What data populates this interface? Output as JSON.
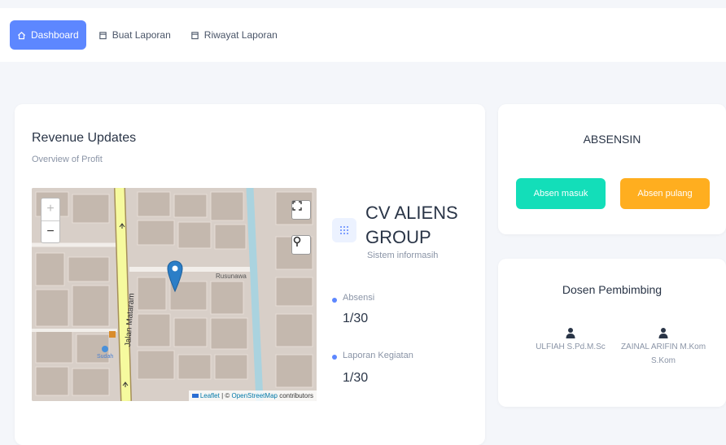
{
  "nav": {
    "items": [
      {
        "label": "Dashboard",
        "icon": "home-icon",
        "active": true
      },
      {
        "label": "Buat Laporan",
        "icon": "document-icon",
        "active": false
      },
      {
        "label": "Riwayat Laporan",
        "icon": "document-icon",
        "active": false
      }
    ]
  },
  "revenue": {
    "title": "Revenue Updates",
    "subtitle": "Overview of Profit"
  },
  "map": {
    "zoom_in": "+",
    "zoom_out": "−",
    "street_label": "Jalan Mataram",
    "area_label": "Rusunawa",
    "place_label": "Sudah",
    "attribution_leaflet": "Leaflet",
    "attribution_sep": " | © ",
    "attribution_osm": "OpenStreetMap",
    "attribution_tail": " contributors"
  },
  "company": {
    "name": "CV ALIENS GROUP",
    "subtitle": "Sistem informasih",
    "stats": [
      {
        "label": "Absensi",
        "value": "1/30"
      },
      {
        "label": "Laporan Kegiatan",
        "value": "1/30"
      }
    ]
  },
  "absensi": {
    "title": "ABSENSIN",
    "masuk_label": "Absen masuk",
    "pulang_label": "Absen pulang"
  },
  "dosen": {
    "title": "Dosen Pembimbing",
    "people": [
      {
        "name": "ULFIAH S.Pd.M.Sc"
      },
      {
        "name": "ZAINAL ARIFIN M.Kom S.Kom"
      }
    ]
  },
  "colors": {
    "primary": "#5d87ff",
    "success": "#13deb9",
    "warning": "#ffae1f",
    "map_pin": "#2b7ec7"
  }
}
